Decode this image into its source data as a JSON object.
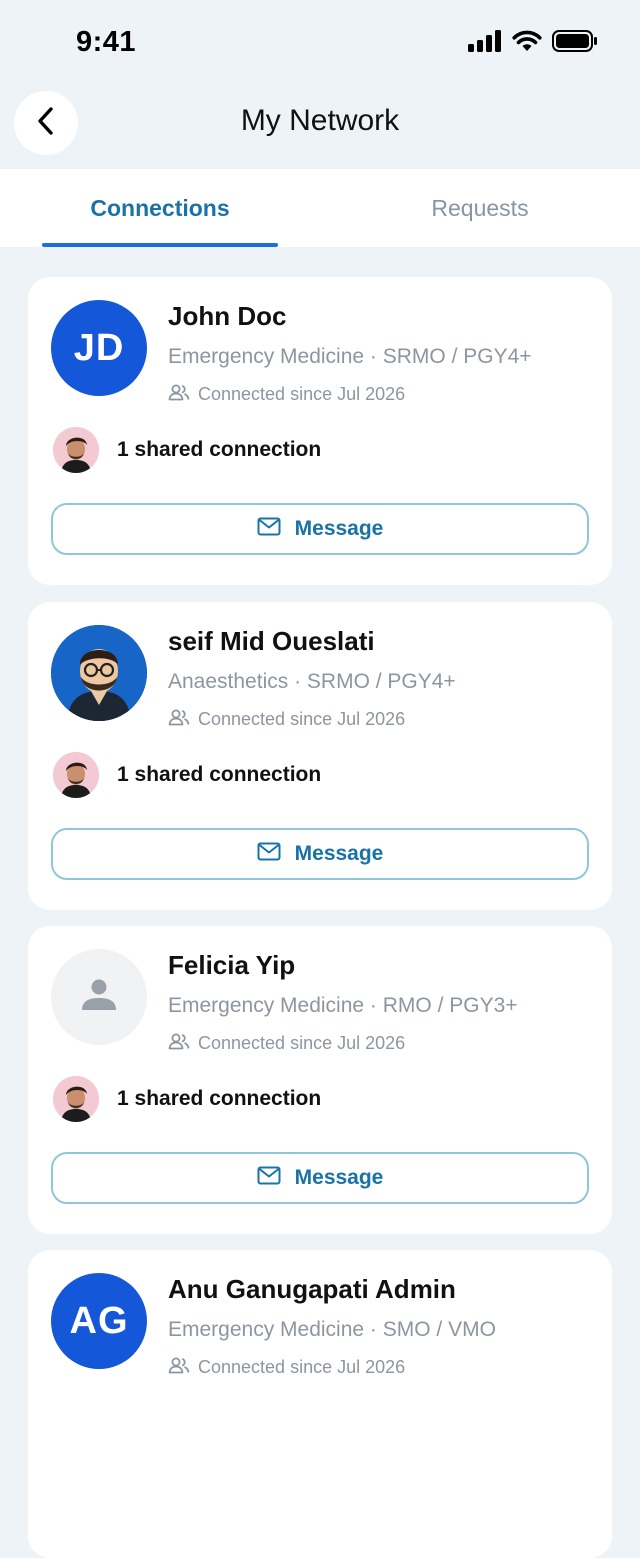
{
  "status_bar": {
    "time": "9:41"
  },
  "header": {
    "title": "My Network"
  },
  "tabs": [
    {
      "label": "Connections",
      "active": true
    },
    {
      "label": "Requests",
      "active": false
    }
  ],
  "colors": {
    "accent": "#1a73a8",
    "avatar_blue": "#1457d8",
    "underline": "#1e6fd9",
    "background": "#eef3f7"
  },
  "connections": [
    {
      "name": "John Doc",
      "initials": "JD",
      "specialty": "Emergency Medicine · SRMO / PGY4+",
      "since": "Connected since Jul 2026",
      "shared": "1 shared connection",
      "message_label": "Message"
    },
    {
      "name": "seif Mid Oueslati",
      "initials": "",
      "specialty": "Anaesthetics · SRMO / PGY4+",
      "since": "Connected since Jul 2026",
      "shared": "1 shared connection",
      "message_label": "Message"
    },
    {
      "name": "Felicia Yip",
      "initials": "",
      "specialty": "Emergency Medicine · RMO / PGY3+",
      "since": "Connected since Jul 2026",
      "shared": "1 shared connection",
      "message_label": "Message"
    },
    {
      "name": "Anu Ganugapati Admin",
      "initials": "AG",
      "specialty": "Emergency Medicine · SMO / VMO",
      "since": "Connected since Jul 2026"
    }
  ]
}
